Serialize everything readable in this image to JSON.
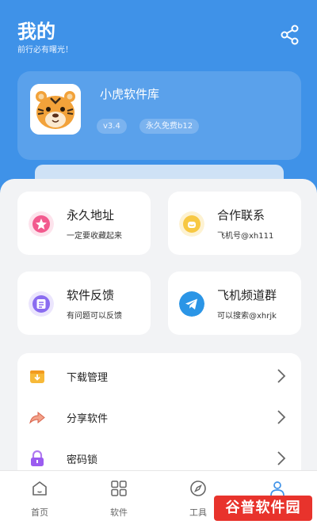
{
  "header": {
    "title": "我的",
    "subtitle": "前行必有曙光！",
    "share_icon": "share-icon"
  },
  "profile": {
    "app_name": "小虎软件库",
    "version_badge": "v3.4",
    "license_badge": "永久免费b12",
    "avatar_icon": "tiger-avatar-icon"
  },
  "tiles": [
    {
      "title": "永久地址",
      "subtitle": "一定要收藏起来",
      "icon": "star-icon",
      "color": "#f25a8e"
    },
    {
      "title": "合作联系",
      "subtitle": "飞机号@xh111",
      "icon": "smile-icon",
      "color": "#f7c843"
    },
    {
      "title": "软件反馈",
      "subtitle": "有问题可以反馈",
      "icon": "feedback-icon",
      "color": "#8a6cf0"
    },
    {
      "title": "飞机频道群",
      "subtitle": "可以搜索@xhrjk",
      "icon": "telegram-icon",
      "color": "#2b95e6"
    }
  ],
  "menu": [
    {
      "label": "下载管理",
      "icon": "download-icon"
    },
    {
      "label": "分享软件",
      "icon": "share-arrow-icon"
    },
    {
      "label": "密码锁",
      "icon": "lock-icon"
    }
  ],
  "tabs": [
    {
      "label": "首页",
      "icon": "home-icon"
    },
    {
      "label": "软件",
      "icon": "grid-icon"
    },
    {
      "label": "工具",
      "icon": "compass-icon"
    },
    {
      "label": "",
      "icon": "user-icon",
      "active": true
    }
  ],
  "watermark": "谷普软件园",
  "colors": {
    "accent": "#3f92e8",
    "background": "#f2f3f5"
  }
}
